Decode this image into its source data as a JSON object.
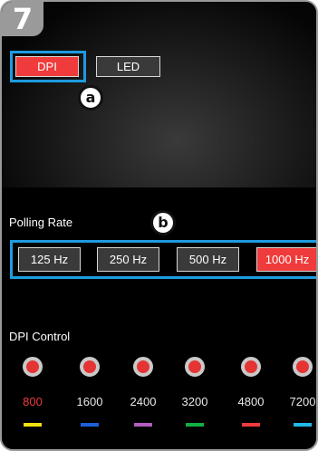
{
  "step": "7",
  "tabs": {
    "dpi": "DPI",
    "led": "LED"
  },
  "callouts": {
    "a": "a",
    "b": "b"
  },
  "polling": {
    "title": "Polling Rate",
    "options": [
      "125 Hz",
      "250 Hz",
      "500 Hz",
      "1000 Hz"
    ],
    "selected": "1000 Hz"
  },
  "dpi_control": {
    "title": "DPI Control",
    "levels": [
      "800",
      "1600",
      "2400",
      "3200",
      "4800",
      "7200"
    ],
    "active": "800",
    "level_colors": [
      "#f2e010",
      "#1f5fd8",
      "#b45cc0",
      "#12b040",
      "#ef3b3b",
      "#22b8e8"
    ]
  },
  "colors": {
    "accent_red": "#ef3b3b",
    "highlight_blue": "#1e9be0",
    "active_text": "#ef3b3b"
  }
}
